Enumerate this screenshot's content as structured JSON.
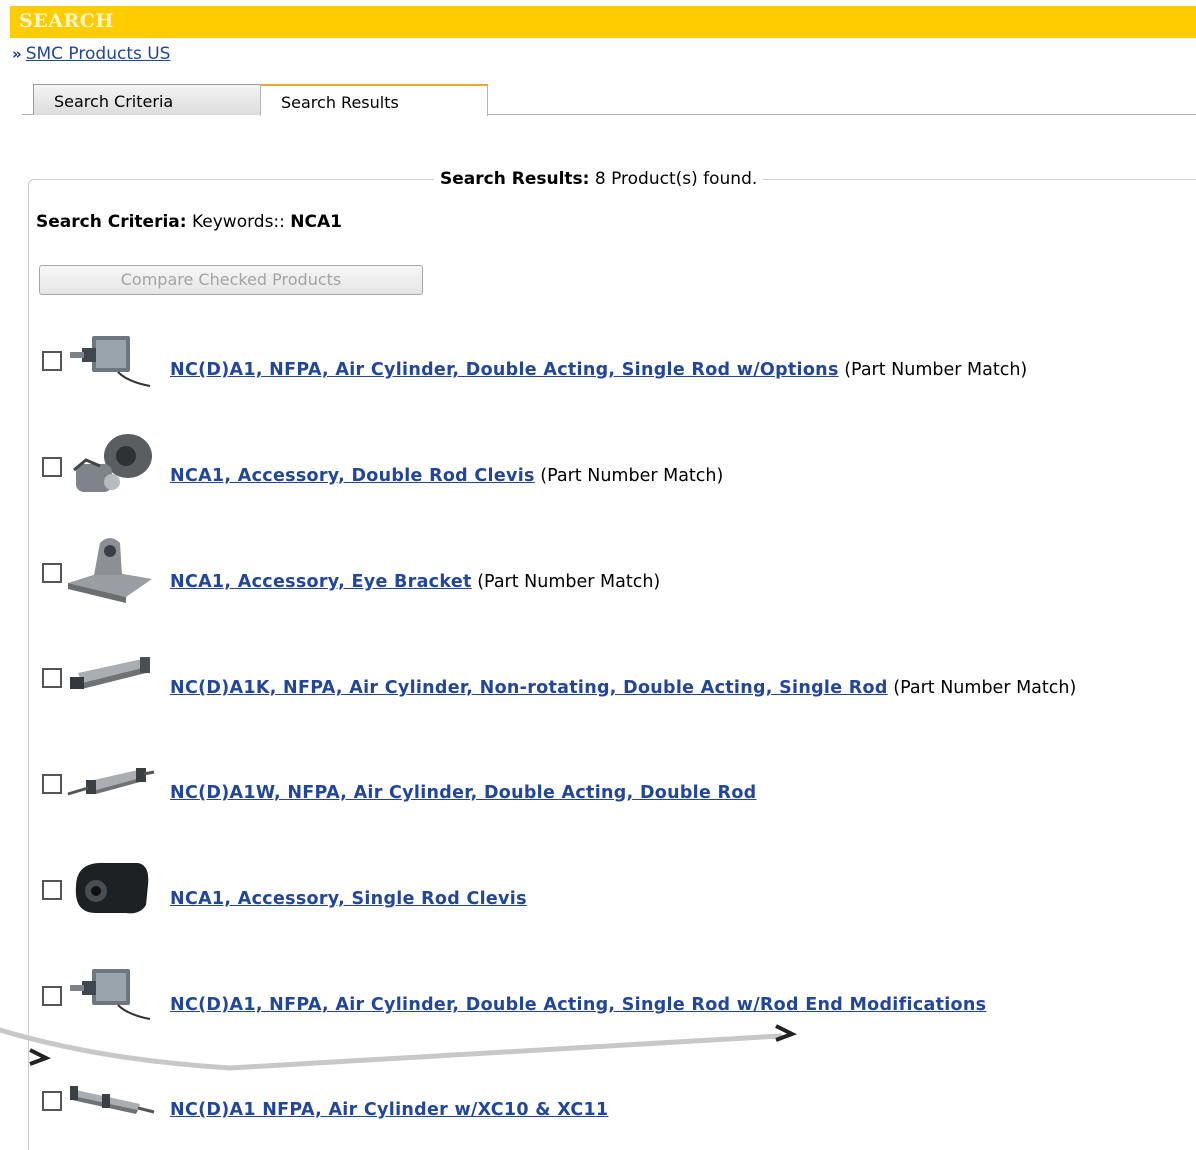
{
  "header": {
    "title": "SEARCH"
  },
  "breadcrumb": {
    "arrow": "»",
    "link": "SMC Products US"
  },
  "tabs": [
    {
      "label": "Search Criteria"
    },
    {
      "label": "Search Results"
    }
  ],
  "results": {
    "legend_label": "Search Results:",
    "legend_text": " 8 Product(s) found.",
    "criteria_label": "Search Criteria:",
    "criteria_text": " Keywords:: ",
    "criteria_value": "NCA1",
    "compare_button": "Compare Checked Products",
    "products": [
      {
        "title": "NC(D)A1, NFPA, Air Cylinder, Double Acting, Single Rod w/Options",
        "match": " (Part Number Match)",
        "icon": "air-cylinder-icon"
      },
      {
        "title": "NCA1, Accessory, Double Rod Clevis",
        "match": " (Part Number Match)",
        "icon": "double-rod-clevis-icon"
      },
      {
        "title": "NCA1, Accessory, Eye Bracket",
        "match": " (Part Number Match)",
        "icon": "eye-bracket-icon"
      },
      {
        "title": "NC(D)A1K, NFPA, Air Cylinder, Non-rotating, Double Acting, Single Rod",
        "match": " (Part Number Match)",
        "icon": "cylinder-long-icon"
      },
      {
        "title": "NC(D)A1W, NFPA, Air Cylinder, Double Acting, Double Rod",
        "match": "",
        "icon": "double-rod-cylinder-icon"
      },
      {
        "title": "NCA1, Accessory, Single Rod Clevis",
        "match": "",
        "icon": "single-rod-clevis-icon"
      },
      {
        "title": "NC(D)A1, NFPA, Air Cylinder, Double Acting, Single Rod w/Rod End Modifications",
        "match": "",
        "icon": "air-cylinder-icon"
      },
      {
        "title": "NC(D)A1 NFPA, Air Cylinder w/XC10 & XC11",
        "match": "",
        "icon": "tandem-cylinder-icon"
      }
    ]
  }
}
